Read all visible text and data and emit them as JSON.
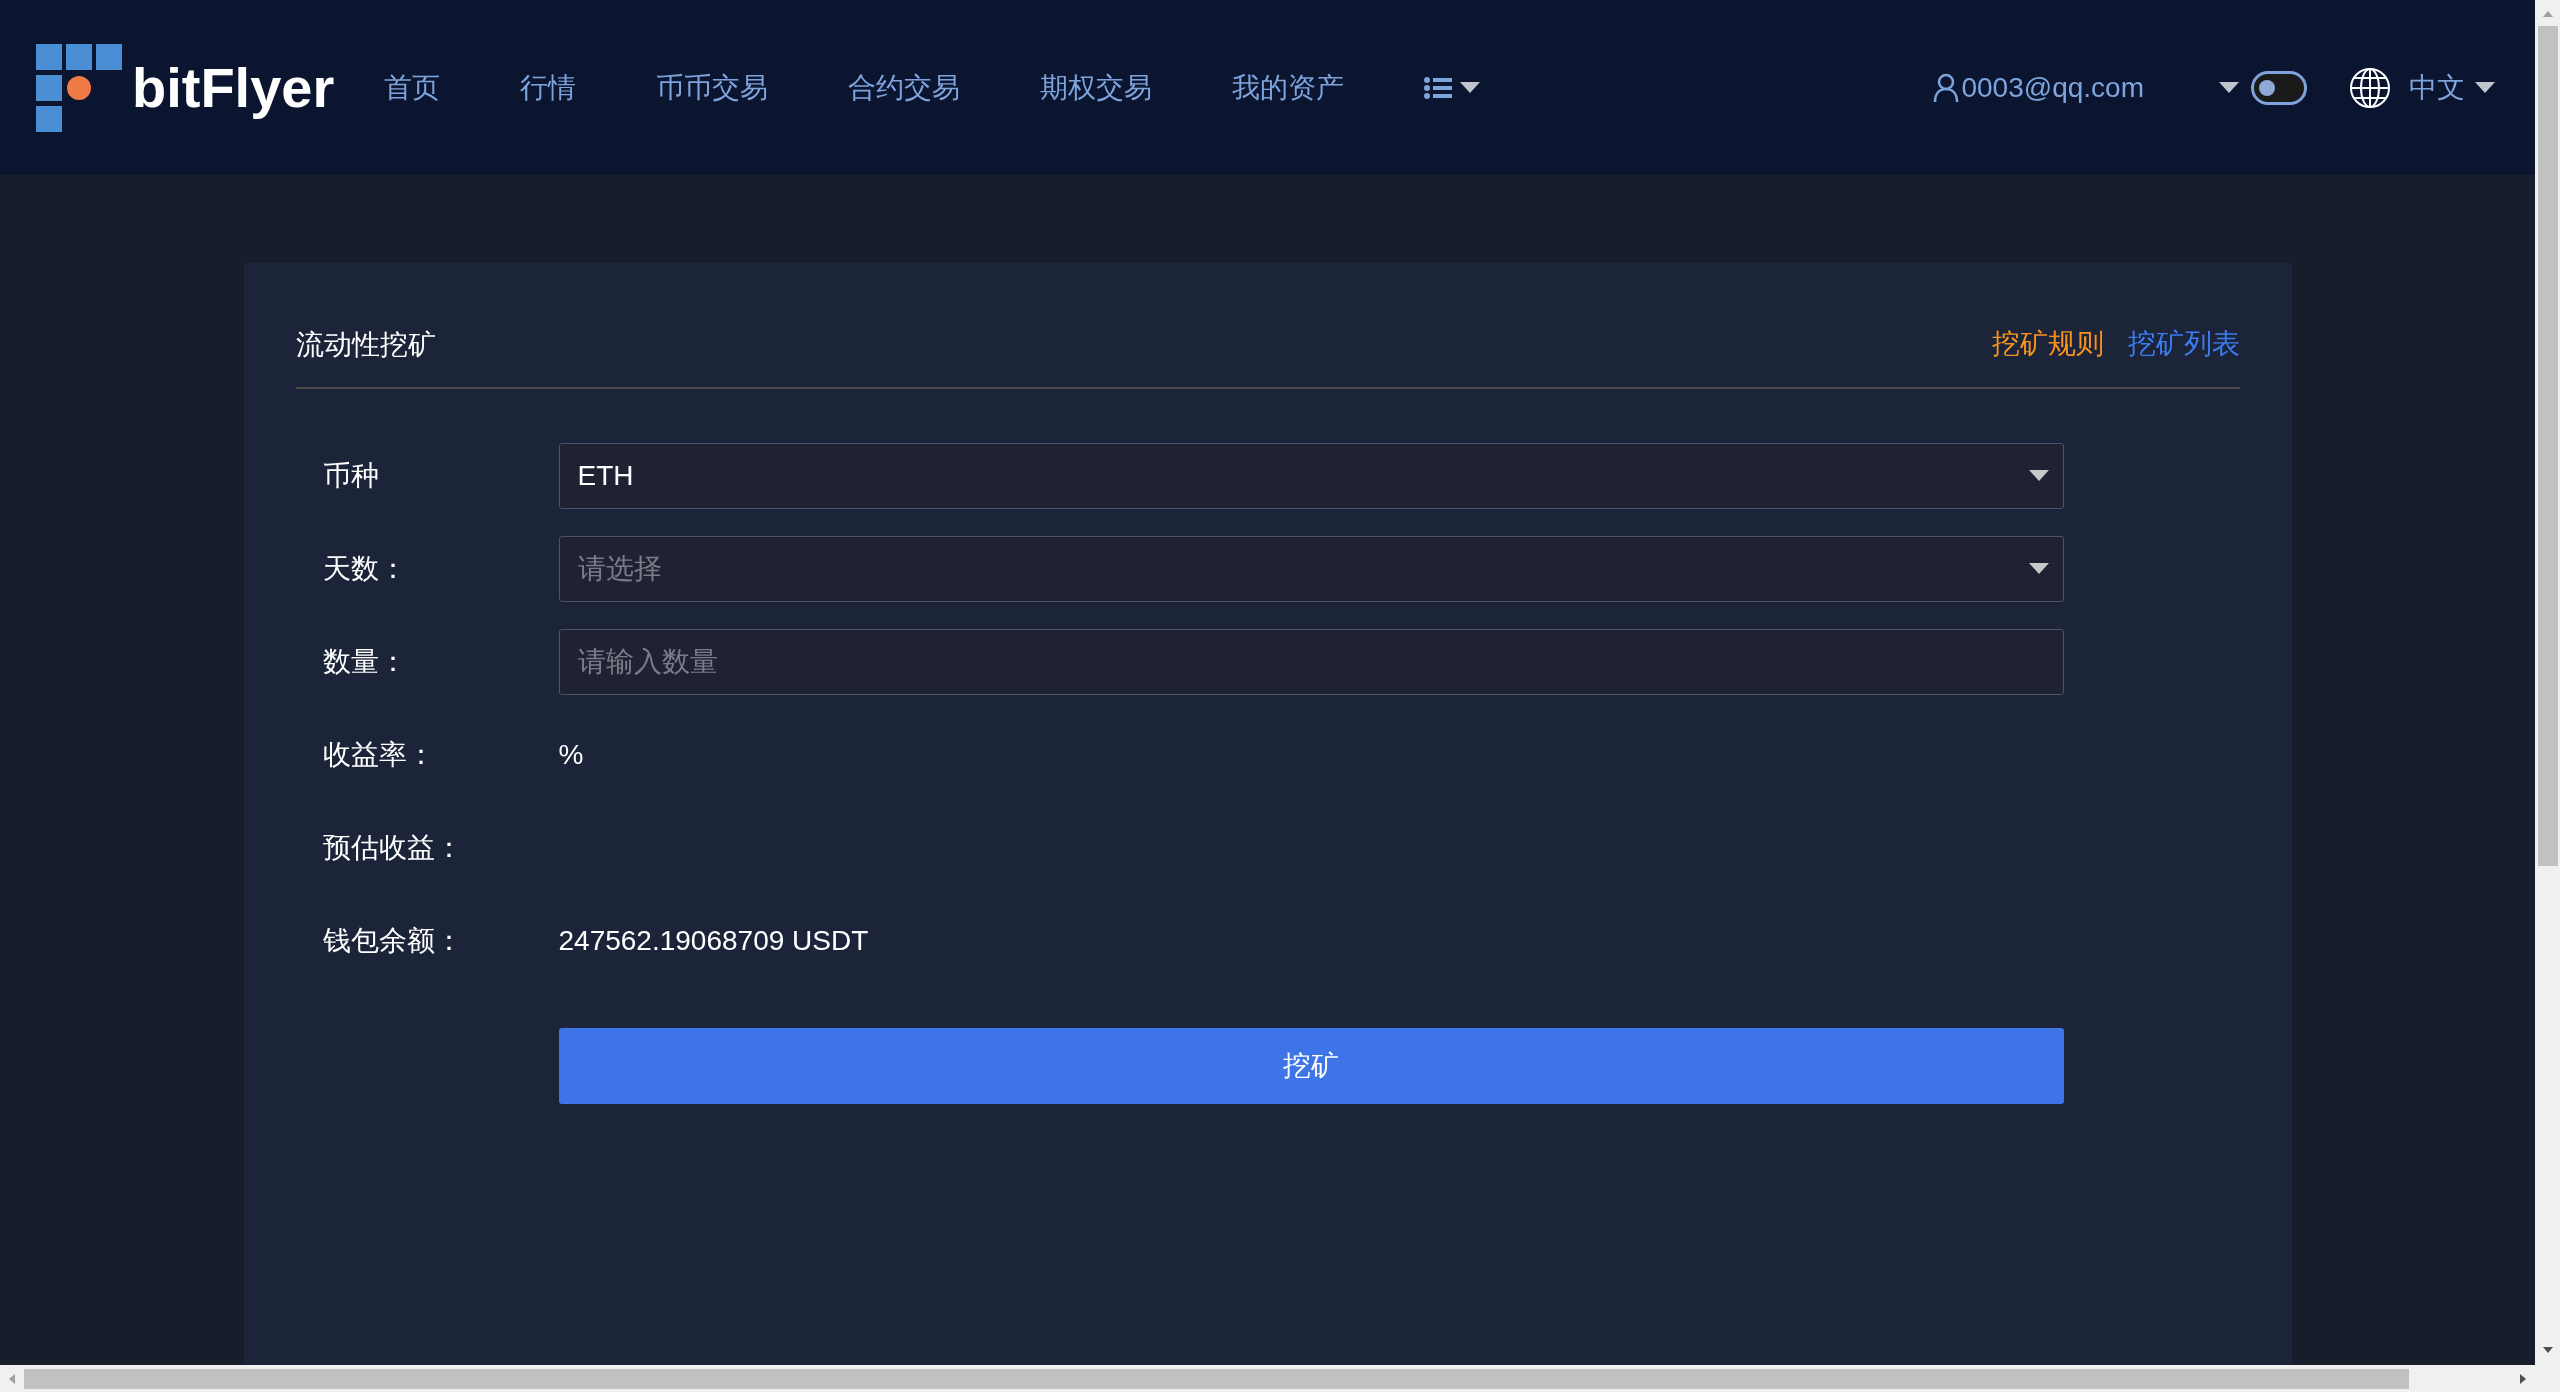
{
  "header": {
    "logo_text": "bitFlyer",
    "nav": [
      {
        "label": "首页"
      },
      {
        "label": "行情"
      },
      {
        "label": "币币交易"
      },
      {
        "label": "合约交易"
      },
      {
        "label": "期权交易"
      },
      {
        "label": "我的资产"
      }
    ],
    "user_email": "0003@qq.com",
    "theme_toggle": {
      "on": false
    },
    "language": "中文"
  },
  "card": {
    "title": "流动性挖矿",
    "links": [
      {
        "label": "挖矿规则",
        "color": "#f7931e"
      },
      {
        "label": "挖矿列表",
        "color": "#3d7bf0"
      }
    ],
    "rows": [
      {
        "kind": "select",
        "label": "币种",
        "value": "ETH"
      },
      {
        "kind": "select",
        "label": "天数：",
        "placeholder": "请选择"
      },
      {
        "kind": "input",
        "label": "数量：",
        "placeholder": "请输入数量"
      },
      {
        "kind": "text",
        "label": "收益率：",
        "value": "%"
      },
      {
        "kind": "text",
        "label": "预估收益："
      },
      {
        "kind": "text",
        "label": "钱包余额：",
        "value": "247562.19068709 USDT"
      }
    ],
    "submit": "挖矿"
  }
}
